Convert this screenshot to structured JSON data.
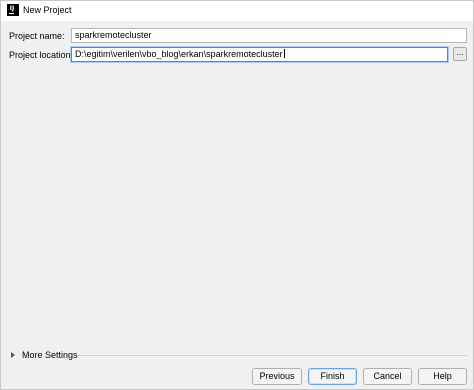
{
  "window": {
    "title": "New Project",
    "app_icon": "intellij-idea-icon"
  },
  "form": {
    "project_name": {
      "label": "Project name:",
      "value": "sparkremotecluster"
    },
    "project_location": {
      "label": "Project location:",
      "value": "D:\\egitim\\verilen\\vbo_blog\\erkan\\sparkremotecluster",
      "browse_label": "..."
    }
  },
  "more_settings": {
    "label": "More Settings",
    "expanded": false
  },
  "buttons": {
    "previous": "Previous",
    "finish": "Finish",
    "cancel": "Cancel",
    "help": "Help"
  }
}
